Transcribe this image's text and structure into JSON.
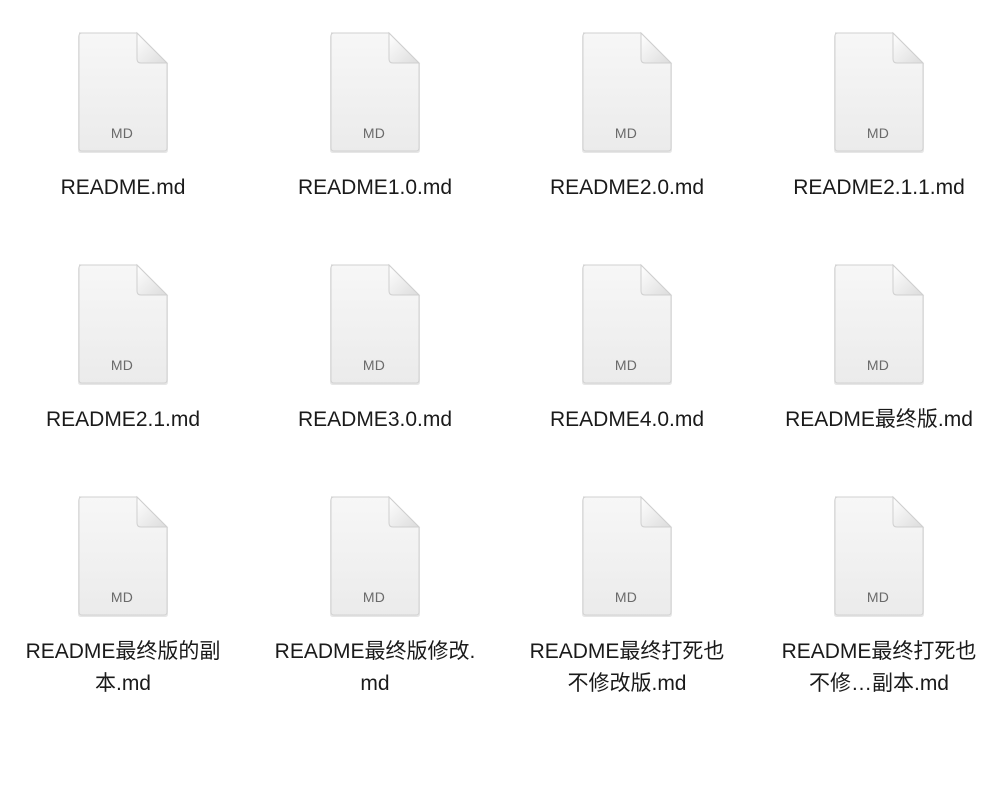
{
  "files": [
    {
      "name": "README.md",
      "ext": "MD"
    },
    {
      "name": "README1.0.md",
      "ext": "MD"
    },
    {
      "name": "README2.0.md",
      "ext": "MD"
    },
    {
      "name": "README2.1.1.md",
      "ext": "MD"
    },
    {
      "name": "README2.1.md",
      "ext": "MD"
    },
    {
      "name": "README3.0.md",
      "ext": "MD"
    },
    {
      "name": "README4.0.md",
      "ext": "MD"
    },
    {
      "name": "README最终版.md",
      "ext": "MD"
    },
    {
      "name": "README最终版的副本.md",
      "ext": "MD"
    },
    {
      "name": "README最终版修改.md",
      "ext": "MD"
    },
    {
      "name": "README最终打死也不修改版.md",
      "ext": "MD"
    },
    {
      "name": "README最终打死也不修…副本.md",
      "ext": "MD"
    }
  ]
}
